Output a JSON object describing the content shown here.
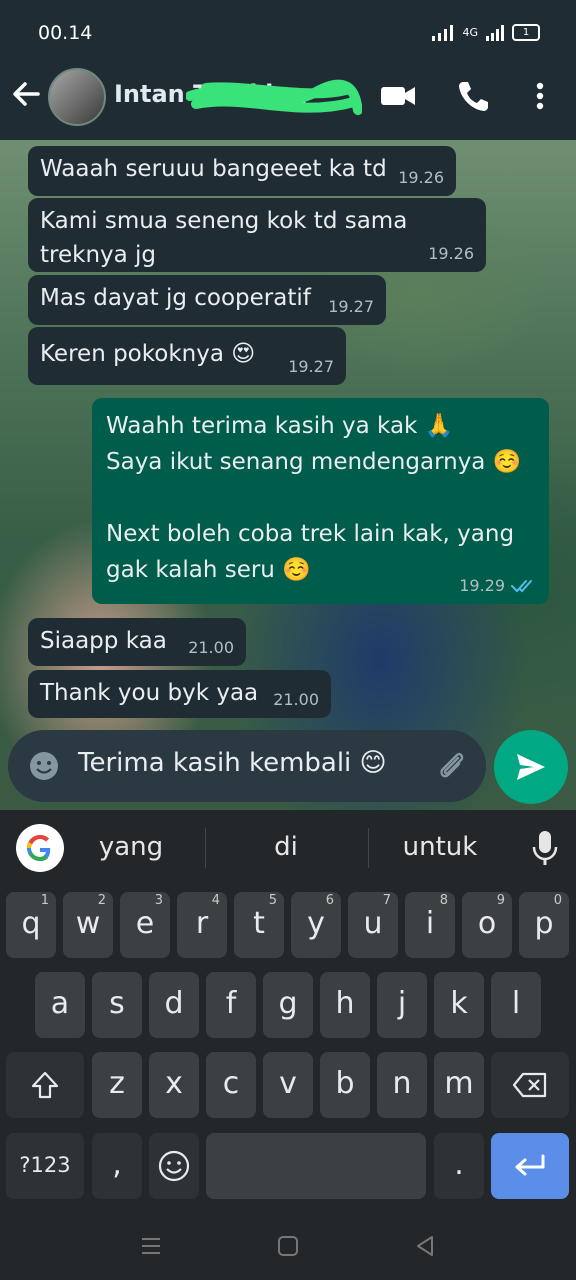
{
  "status_bar": {
    "time": "00.14",
    "network": "4G",
    "battery": "1"
  },
  "contact": {
    "name": "Intan Tracking"
  },
  "messages": [
    {
      "dir": "in",
      "text": "Waaah seruuu bangeeet ka td",
      "time": "19.26"
    },
    {
      "dir": "in",
      "text": "Kami smua seneng kok td sama treknya jg",
      "time": "19.26"
    },
    {
      "dir": "in",
      "text": "Mas dayat jg cooperatif",
      "time": "19.27"
    },
    {
      "dir": "in",
      "text": "Keren pokoknya 😍",
      "time": "19.27"
    },
    {
      "dir": "out",
      "text": "Waahh terima kasih ya kak 🙏\nSaya ikut senang mendengarnya ☺️\n\nNext boleh coba trek lain kak, yang gak kalah seru ☺️",
      "time": "19.29",
      "status": "read"
    },
    {
      "dir": "in",
      "text": "Siaapp kaa",
      "time": "21.00"
    },
    {
      "dir": "in",
      "text": "Thank you byk yaa",
      "time": "21.00"
    }
  ],
  "composer": {
    "value": "Terima kasih kembali 😊"
  },
  "keyboard": {
    "suggestions": [
      "yang",
      "di",
      "untuk"
    ],
    "row1": [
      {
        "k": "q",
        "n": "1"
      },
      {
        "k": "w",
        "n": "2"
      },
      {
        "k": "e",
        "n": "3"
      },
      {
        "k": "r",
        "n": "4"
      },
      {
        "k": "t",
        "n": "5"
      },
      {
        "k": "y",
        "n": "6"
      },
      {
        "k": "u",
        "n": "7"
      },
      {
        "k": "i",
        "n": "8"
      },
      {
        "k": "o",
        "n": "9"
      },
      {
        "k": "p",
        "n": "0"
      }
    ],
    "row2": [
      "a",
      "s",
      "d",
      "f",
      "g",
      "h",
      "j",
      "k",
      "l"
    ],
    "row3": [
      "z",
      "x",
      "c",
      "v",
      "b",
      "n",
      "m"
    ],
    "symbols_label": "?123",
    "comma": ",",
    "period": "."
  },
  "colors": {
    "incoming": "#202c33",
    "outgoing": "#005c4b",
    "accent": "#00a884",
    "read_ticks": "#53bdeb"
  },
  "icons": [
    "back-arrow-icon",
    "video-call-icon",
    "phone-icon",
    "more-vert-icon",
    "emoji-icon",
    "attach-icon",
    "send-icon",
    "google-icon",
    "mic-icon",
    "shift-icon",
    "backspace-icon",
    "enter-icon"
  ]
}
